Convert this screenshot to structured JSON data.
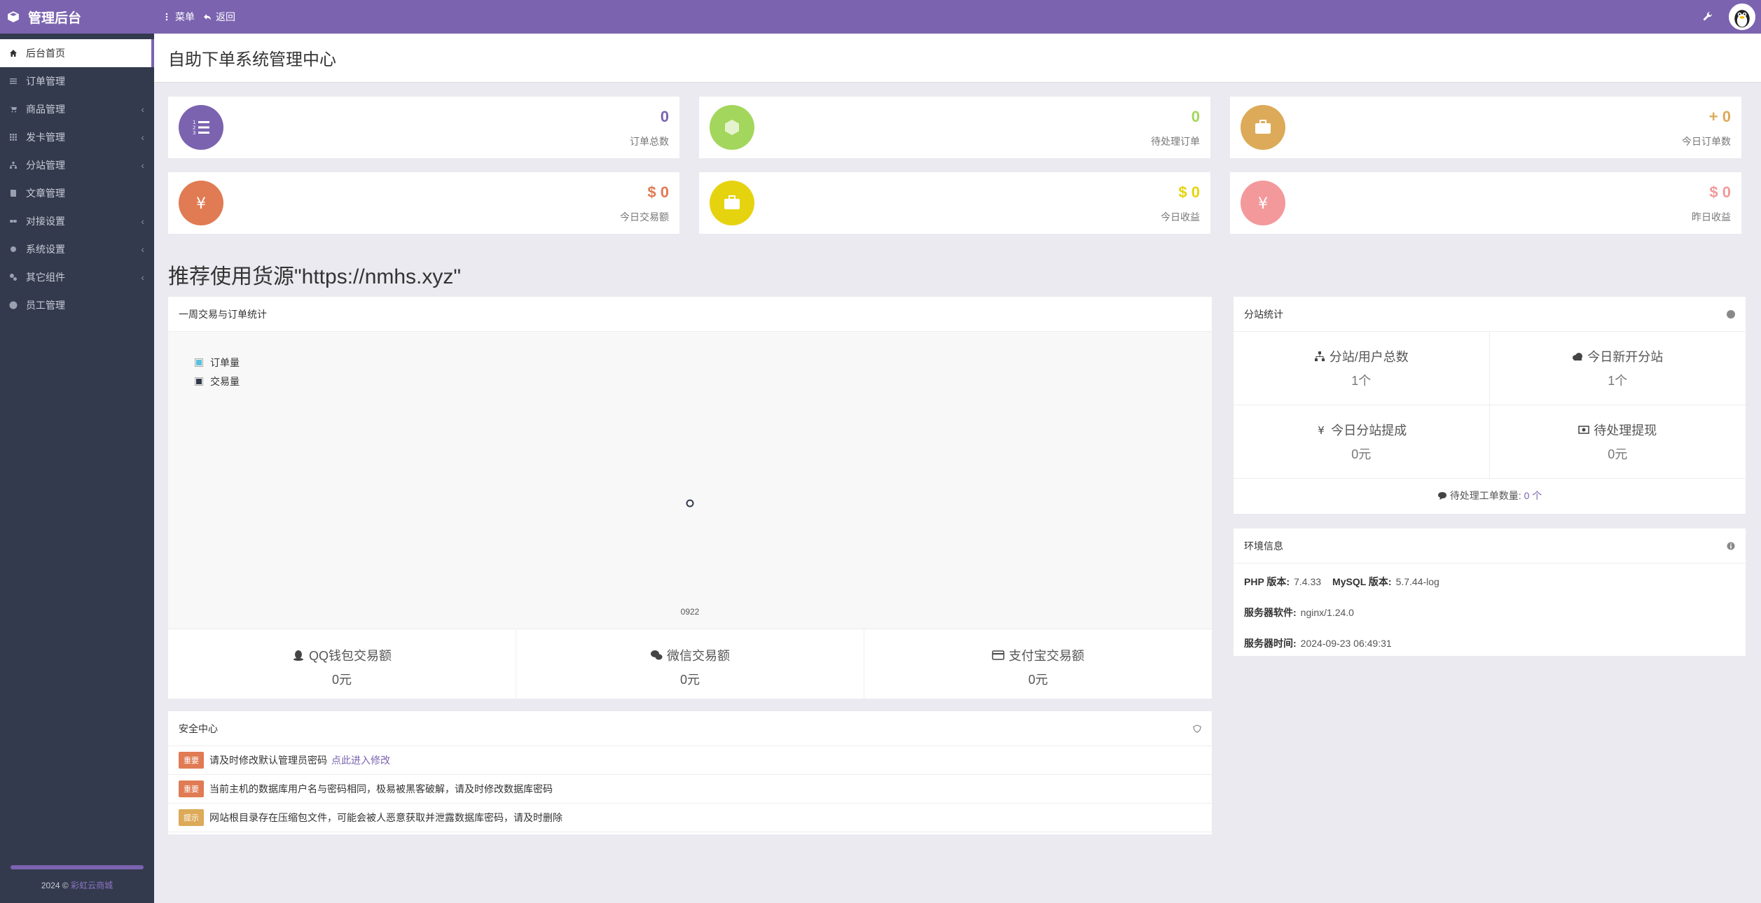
{
  "app": {
    "title": "管理后台"
  },
  "topbar": {
    "menu_label": "菜单",
    "back_label": "返回"
  },
  "sidebar": {
    "items": [
      {
        "label": "后台首页",
        "icon": "home-icon",
        "active": true,
        "has_children": false
      },
      {
        "label": "订单管理",
        "icon": "list-icon",
        "has_children": false
      },
      {
        "label": "商品管理",
        "icon": "cart-icon",
        "has_children": true
      },
      {
        "label": "发卡管理",
        "icon": "grid-icon",
        "has_children": true
      },
      {
        "label": "分站管理",
        "icon": "sitemap-icon",
        "has_children": true
      },
      {
        "label": "文章管理",
        "icon": "book-icon",
        "has_children": false
      },
      {
        "label": "对接设置",
        "icon": "link-icon",
        "has_children": true
      },
      {
        "label": "系统设置",
        "icon": "gear-icon",
        "has_children": true
      },
      {
        "label": "其它组件",
        "icon": "gears-icon",
        "has_children": true
      },
      {
        "label": "员工管理",
        "icon": "user-icon",
        "has_children": false
      }
    ],
    "chevron": "‹",
    "footer": {
      "year": "2024 ©",
      "link_text": "彩虹云商城"
    }
  },
  "page": {
    "title": "自助下单系统管理中心"
  },
  "stats": [
    {
      "value": "0",
      "label": "订单总数",
      "color": "#7b63b0",
      "value_color": "#7b63b0",
      "icon": "list-ol-icon"
    },
    {
      "value": "0",
      "label": "待处理订单",
      "color": "#a3d65c",
      "value_color": "#a3d65c",
      "icon": "cube-icon"
    },
    {
      "value": "+ 0",
      "label": "今日订单数",
      "color": "#dcaa58",
      "value_color": "#dcaa58",
      "icon": "briefcase-icon"
    },
    {
      "value": "$ 0",
      "label": "今日交易额",
      "color": "#e07b53",
      "value_color": "#e07b53",
      "icon": "yen-icon"
    },
    {
      "value": "$ 0",
      "label": "今日收益",
      "color": "#e6d30f",
      "value_color": "#e6d30f",
      "icon": "briefcase-icon"
    },
    {
      "value": "$ 0",
      "label": "昨日收益",
      "color": "#f3999b",
      "value_color": "#f3999b",
      "icon": "yen-icon"
    }
  ],
  "promo": "推荐使用货源\"https://nmhs.xyz\"",
  "chart_panel": {
    "title": "一周交易与订单统计",
    "legend": [
      {
        "name": "订单量",
        "color": "#5bc0de"
      },
      {
        "name": "交易量",
        "color": "#333a4d"
      }
    ],
    "x_tick": "0922"
  },
  "chart_data": {
    "type": "line",
    "x": [
      "0922"
    ],
    "series": [
      {
        "name": "订单量",
        "values": [
          0
        ]
      },
      {
        "name": "交易量",
        "values": [
          0
        ]
      }
    ],
    "legend_placement": "top-left"
  },
  "transactions": [
    {
      "label": "QQ钱包交易额",
      "value": "0元",
      "icon": "qq-icon"
    },
    {
      "label": "微信交易额",
      "value": "0元",
      "icon": "wechat-icon"
    },
    {
      "label": "支付宝交易额",
      "value": "0元",
      "icon": "credit-card-icon"
    }
  ],
  "security": {
    "title": "安全中心",
    "rows": [
      {
        "badge": "重要",
        "badge_color": "#e07b53",
        "text": "请及时修改默认管理员密码",
        "link": "点此进入修改"
      },
      {
        "badge": "重要",
        "badge_color": "#e07b53",
        "text": "当前主机的数据库用户名与密码相同，极易被黑客破解，请及时修改数据库密码",
        "link": ""
      },
      {
        "badge": "提示",
        "badge_color": "#dcaa58",
        "text": "网站根目录存在压缩包文件，可能会被人恶意获取并泄露数据库密码，请及时删除",
        "link": ""
      }
    ]
  },
  "substation": {
    "title": "分站统计",
    "cells": [
      {
        "label": "分站/用户总数",
        "value": "1个",
        "icon": "sitemap-icon"
      },
      {
        "label": "今日新开分站",
        "value": "1个",
        "icon": "cloud-icon"
      },
      {
        "label": "今日分站提成",
        "value": "0元",
        "icon": "yen-icon"
      },
      {
        "label": "待处理提现",
        "value": "0元",
        "icon": "money-icon"
      }
    ],
    "pending_label": "待处理工单数量:",
    "pending_count": "0 个"
  },
  "env": {
    "title": "环境信息",
    "php_label": "PHP 版本:",
    "php_value": "7.4.33",
    "mysql_label": "MySQL 版本:",
    "mysql_value": "5.7.44-log",
    "server_label": "服务器软件:",
    "server_value": "nginx/1.24.0",
    "time_label": "服务器时间:",
    "time_value": "2024-09-23 06:49:31"
  }
}
